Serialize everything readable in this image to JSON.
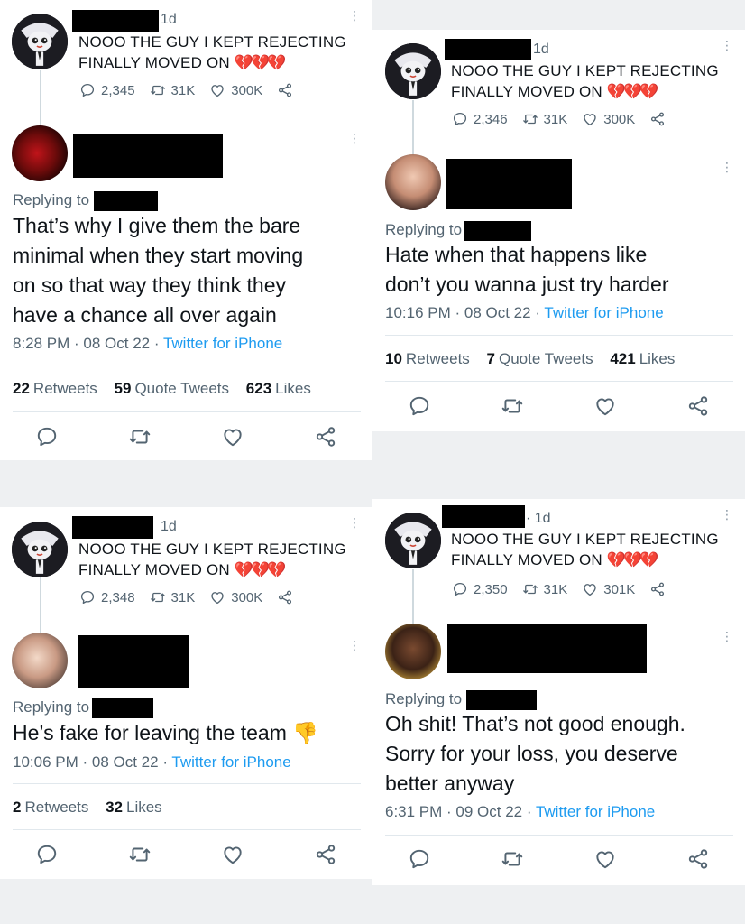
{
  "colors": {
    "link": "#1d9bf0",
    "muted": "#536471",
    "heart": "#e0245e"
  },
  "original_tweet": {
    "text_line1": "NOOO THE GUY I KEPT REJECTING",
    "text_line2": "FINALLY MOVED ON",
    "hearts": "💔💔💔",
    "time_ago": "1d"
  },
  "panels": [
    {
      "original": {
        "time_ago": "1d",
        "replies": "2,345",
        "retweets": "31K",
        "likes": "300K"
      },
      "reply": {
        "replying_to": "Replying to",
        "lines": [
          "That’s why I give them the bare",
          "minimal when they start moving",
          "on so that way they think they",
          "have a chance all over again"
        ],
        "time": "8:28 PM",
        "date": "08 Oct 22",
        "source": "Twitter for iPhone",
        "retweets": "22",
        "retweets_label": "Retweets",
        "quotes": "59",
        "quotes_label": "Quote Tweets",
        "likes": "623",
        "likes_label": "Likes"
      }
    },
    {
      "original": {
        "time_ago": "1d",
        "replies": "2,346",
        "retweets": "31K",
        "likes": "300K"
      },
      "reply": {
        "replying_to": "Replying to",
        "lines": [
          "Hate when that happens like",
          "don’t you wanna just try harder"
        ],
        "time": "10:16 PM",
        "date": "08 Oct 22",
        "source": "Twitter for iPhone",
        "retweets": "10",
        "retweets_label": "Retweets",
        "quotes": "7",
        "quotes_label": "Quote Tweets",
        "likes": "421",
        "likes_label": "Likes"
      }
    },
    {
      "original": {
        "time_ago": "1d",
        "replies": "2,348",
        "retweets": "31K",
        "likes": "300K"
      },
      "reply": {
        "replying_to": "Replying to",
        "lines": [
          "He’s fake for leaving the team 👎"
        ],
        "time": "10:06 PM",
        "date": "08 Oct 22",
        "source": "Twitter for iPhone",
        "retweets": "2",
        "retweets_label": "Retweets",
        "likes": "32",
        "likes_label": "Likes"
      }
    },
    {
      "original": {
        "time_ago": "· 1d",
        "replies": "2,350",
        "retweets": "31K",
        "likes": "301K"
      },
      "reply": {
        "replying_to": "Replying to",
        "lines": [
          "Oh shit! That’s not good enough.",
          "Sorry for your loss, you deserve",
          "better anyway"
        ],
        "time": "6:31 PM",
        "date": "09 Oct 22",
        "source": "Twitter for iPhone"
      }
    }
  ],
  "icons": {
    "reply": "speech-bubble-icon",
    "retweet": "retweet-icon",
    "like": "heart-icon",
    "share": "share-icon",
    "more": "more-vertical-icon"
  }
}
